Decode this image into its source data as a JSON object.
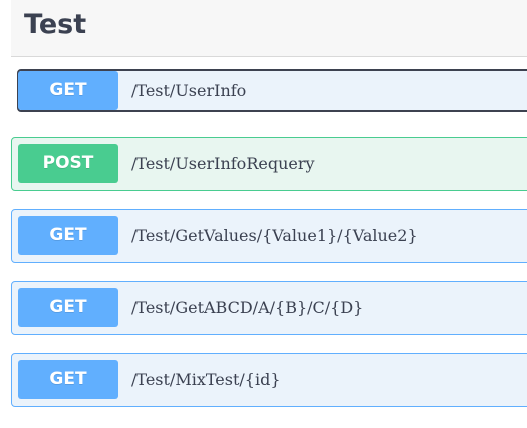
{
  "section": {
    "title": "Test"
  },
  "operations": [
    {
      "method": "GET",
      "path": "/Test/UserInfo"
    },
    {
      "method": "POST",
      "path": "/Test/UserInfoRequery"
    },
    {
      "method": "GET",
      "path": "/Test/GetValues/{Value1}/{Value2}"
    },
    {
      "method": "GET",
      "path": "/Test/GetABCD/A/{B}/C/{D}"
    },
    {
      "method": "GET",
      "path": "/Test/MixTest/{id}"
    }
  ],
  "colors": {
    "get": "#61affe",
    "post": "#49cc90",
    "get_bg": "#ebf3fb",
    "post_bg": "#e8f6f0",
    "title": "#3b4151"
  }
}
